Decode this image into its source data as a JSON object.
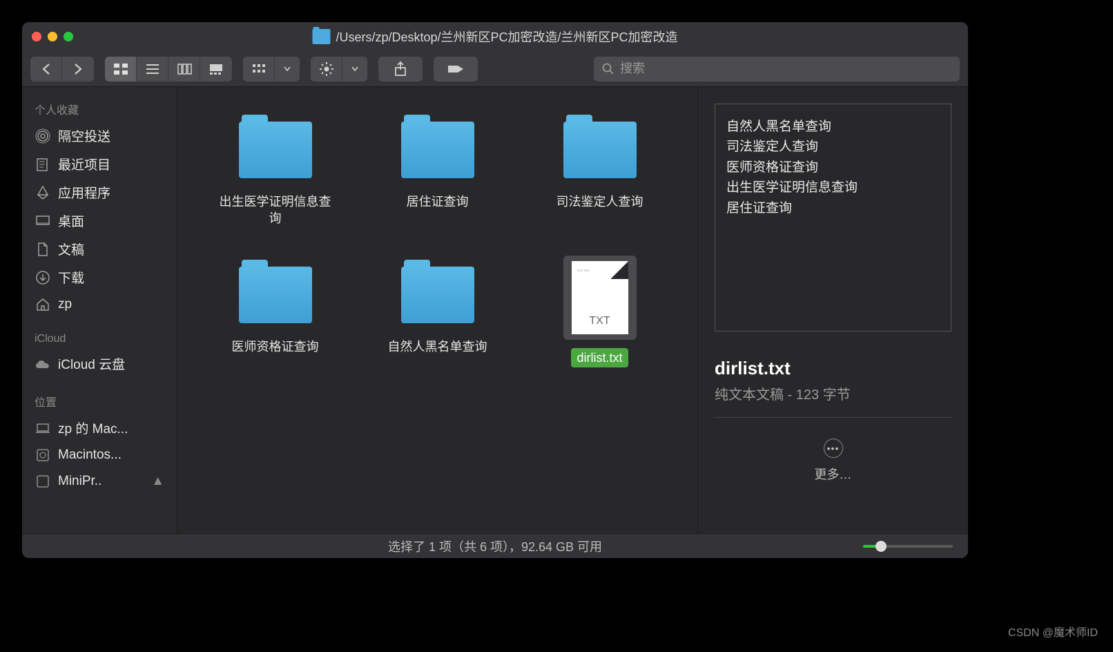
{
  "title_path": "/Users/zp/Desktop/兰州新区PC加密改造/兰州新区PC加密改造",
  "search": {
    "placeholder": "搜索"
  },
  "sidebar": {
    "sections": [
      {
        "header": "个人收藏",
        "items": [
          {
            "label": "隔空投送",
            "icon": "airdrop"
          },
          {
            "label": "最近项目",
            "icon": "recents"
          },
          {
            "label": "应用程序",
            "icon": "apps"
          },
          {
            "label": "桌面",
            "icon": "desktop"
          },
          {
            "label": "文稿",
            "icon": "documents"
          },
          {
            "label": "下载",
            "icon": "downloads"
          },
          {
            "label": "zp",
            "icon": "home"
          }
        ]
      },
      {
        "header": "iCloud",
        "items": [
          {
            "label": "iCloud 云盘",
            "icon": "cloud"
          }
        ]
      },
      {
        "header": "位置",
        "items": [
          {
            "label": "zp 的 Mac...",
            "icon": "laptop"
          },
          {
            "label": "Macintos...",
            "icon": "disk"
          },
          {
            "label": "MiniPr..",
            "icon": "disk"
          }
        ]
      }
    ]
  },
  "files": [
    {
      "name": "出生医学证明信息查询",
      "type": "folder",
      "selected": false
    },
    {
      "name": "居住证查询",
      "type": "folder",
      "selected": false
    },
    {
      "name": "司法鉴定人查询",
      "type": "folder",
      "selected": false
    },
    {
      "name": "医师资格证查询",
      "type": "folder",
      "selected": false
    },
    {
      "name": "自然人黑名单查询",
      "type": "folder",
      "selected": false
    },
    {
      "name": "dirlist.txt",
      "type": "txt",
      "selected": true
    }
  ],
  "preview": {
    "lines": [
      "自然人黑名单查询",
      "司法鉴定人查询",
      "医师资格证查询",
      "出生医学证明信息查询",
      "居住证查询"
    ],
    "filename": "dirlist.txt",
    "subtitle": "纯文本文稿 - 123 字节",
    "more_label": "更多…"
  },
  "status": "选择了 1 项（共 6 项），92.64 GB 可用",
  "txt_badge": "TXT",
  "watermark": "CSDN @魔术师ID"
}
